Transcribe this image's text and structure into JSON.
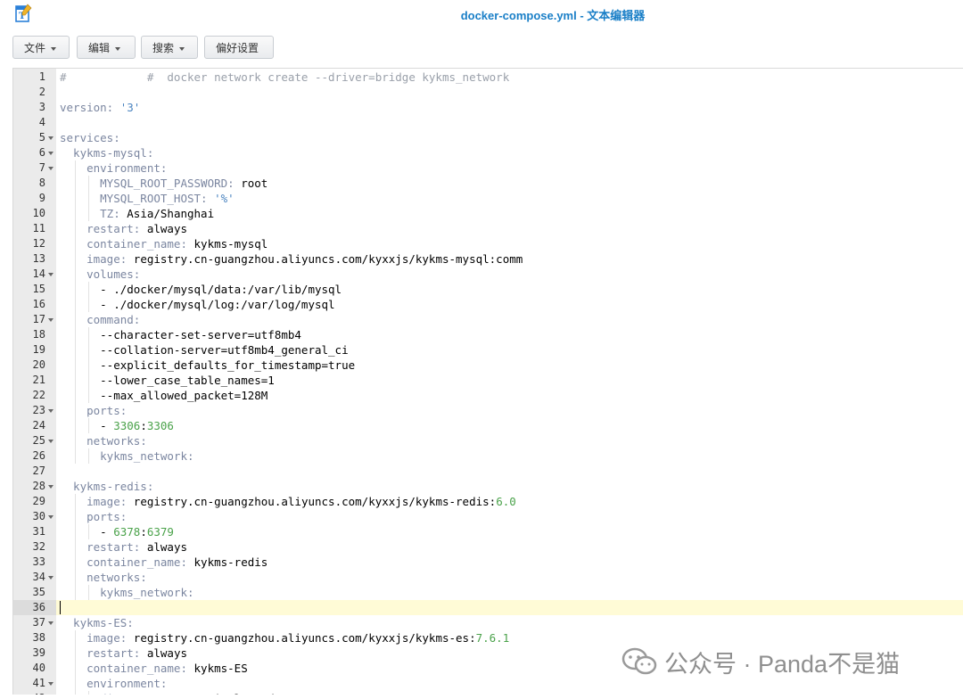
{
  "window": {
    "title": "docker-compose.yml - 文本编辑器"
  },
  "toolbar": {
    "menus": [
      {
        "label": "文件",
        "has_caret": true
      },
      {
        "label": "编辑",
        "has_caret": true
      },
      {
        "label": "搜索",
        "has_caret": true
      },
      {
        "label": "偏好设置",
        "has_caret": false
      }
    ]
  },
  "editor": {
    "current_line": 36,
    "folded_marker_lines": [
      5,
      6,
      7,
      14,
      17,
      23,
      25,
      28,
      30,
      34,
      37,
      41
    ],
    "lines": [
      [
        [
          "c",
          "#            #  docker network create --driver=bridge kykms_network"
        ]
      ],
      [],
      [
        [
          "k",
          "version: "
        ],
        [
          "s",
          "'3'"
        ]
      ],
      [],
      [
        [
          "k",
          "services:"
        ]
      ],
      [
        [
          "k",
          "  kykms-mysql:"
        ]
      ],
      [
        [
          "k",
          "    environment:"
        ]
      ],
      [
        [
          "k",
          "      MYSQL_ROOT_PASSWORD: "
        ],
        [
          "t",
          "root"
        ]
      ],
      [
        [
          "k",
          "      MYSQL_ROOT_HOST: "
        ],
        [
          "s",
          "'%'"
        ]
      ],
      [
        [
          "k",
          "      TZ: "
        ],
        [
          "t",
          "Asia/Shanghai"
        ]
      ],
      [
        [
          "k",
          "    restart: "
        ],
        [
          "t",
          "always"
        ]
      ],
      [
        [
          "k",
          "    container_name: "
        ],
        [
          "t",
          "kykms-mysql"
        ]
      ],
      [
        [
          "k",
          "    image: "
        ],
        [
          "t",
          "registry.cn-guangzhou.aliyuncs.com/kyxxjs/kykms-mysql:comm"
        ]
      ],
      [
        [
          "k",
          "    volumes:"
        ]
      ],
      [
        [
          "t",
          "      - ./docker/mysql/data:/var/lib/mysql"
        ]
      ],
      [
        [
          "t",
          "      - ./docker/mysql/log:/var/log/mysql"
        ]
      ],
      [
        [
          "k",
          "    command:"
        ]
      ],
      [
        [
          "t",
          "      --character-set-server=utf8mb4"
        ]
      ],
      [
        [
          "t",
          "      --collation-server=utf8mb4_general_ci"
        ]
      ],
      [
        [
          "t",
          "      --explicit_defaults_for_timestamp=true"
        ]
      ],
      [
        [
          "t",
          "      --lower_case_table_names=1"
        ]
      ],
      [
        [
          "t",
          "      --max_allowed_packet=128M"
        ]
      ],
      [
        [
          "k",
          "    ports:"
        ]
      ],
      [
        [
          "t",
          "      - "
        ],
        [
          "n",
          "3306"
        ],
        [
          "t",
          ":"
        ],
        [
          "n",
          "3306"
        ]
      ],
      [
        [
          "k",
          "    networks:"
        ]
      ],
      [
        [
          "k",
          "      kykms_network:"
        ]
      ],
      [],
      [
        [
          "k",
          "  kykms-redis:"
        ]
      ],
      [
        [
          "k",
          "    image: "
        ],
        [
          "t",
          "registry.cn-guangzhou.aliyuncs.com/kyxxjs/kykms-redis:"
        ],
        [
          "n",
          "6.0"
        ]
      ],
      [
        [
          "k",
          "    ports:"
        ]
      ],
      [
        [
          "t",
          "      - "
        ],
        [
          "n",
          "6378"
        ],
        [
          "t",
          ":"
        ],
        [
          "n",
          "6379"
        ]
      ],
      [
        [
          "k",
          "    restart: "
        ],
        [
          "t",
          "always"
        ]
      ],
      [
        [
          "k",
          "    container_name: "
        ],
        [
          "t",
          "kykms-redis"
        ]
      ],
      [
        [
          "k",
          "    networks:"
        ]
      ],
      [
        [
          "k",
          "      kykms_network:"
        ]
      ],
      [],
      [
        [
          "k",
          "  kykms-ES:"
        ]
      ],
      [
        [
          "k",
          "    image: "
        ],
        [
          "t",
          "registry.cn-guangzhou.aliyuncs.com/kyxxjs/kykms-es:"
        ],
        [
          "n",
          "7.6.1"
        ]
      ],
      [
        [
          "k",
          "    restart: "
        ],
        [
          "t",
          "always"
        ]
      ],
      [
        [
          "k",
          "    container_name: "
        ],
        [
          "t",
          "kykms-ES"
        ]
      ],
      [
        [
          "k",
          "    environment:"
        ]
      ],
      [
        [
          "k",
          "      discovery.type: "
        ],
        [
          "t",
          "single-node"
        ]
      ]
    ]
  },
  "watermark": {
    "text": "公众号 · Panda不是猫"
  },
  "colors": {
    "title": "#1a7fc7",
    "key": "#7b86a0",
    "string": "#4b84c0",
    "number": "#4aa24a"
  }
}
